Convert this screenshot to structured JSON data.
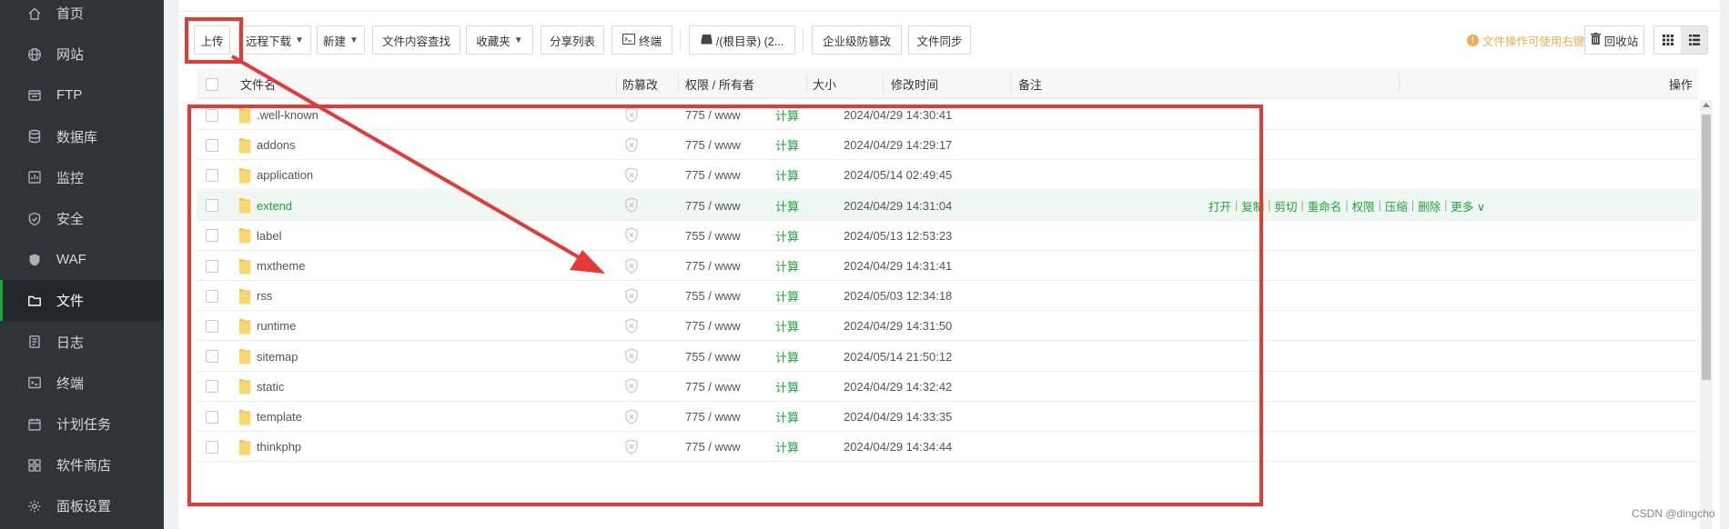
{
  "sidebar": {
    "items": [
      {
        "label": "首页",
        "icon": "home-icon"
      },
      {
        "label": "网站",
        "icon": "globe-icon"
      },
      {
        "label": "FTP",
        "icon": "ftp-icon"
      },
      {
        "label": "数据库",
        "icon": "database-icon"
      },
      {
        "label": "监控",
        "icon": "monitor-icon"
      },
      {
        "label": "安全",
        "icon": "shield-icon"
      },
      {
        "label": "WAF",
        "icon": "waf-shield-icon"
      },
      {
        "label": "文件",
        "icon": "folder-icon",
        "active": true
      },
      {
        "label": "日志",
        "icon": "log-icon"
      },
      {
        "label": "终端",
        "icon": "terminal-icon"
      },
      {
        "label": "计划任务",
        "icon": "calendar-icon"
      },
      {
        "label": "软件商店",
        "icon": "store-icon"
      },
      {
        "label": "面板设置",
        "icon": "gear-icon"
      }
    ]
  },
  "toolbar": {
    "upload": "上传",
    "remote_download": "远程下载",
    "new": "新建",
    "content_search": "文件内容查找",
    "favorites": "收藏夹",
    "share_list": "分享列表",
    "terminal": "终端",
    "path": "/(根目录) (2...",
    "tamper_proof": "企业级防篡改",
    "file_sync": "文件同步",
    "tip": "文件操作可使用右键",
    "recycle_bin": "回收站"
  },
  "table": {
    "headers": {
      "name": "文件名",
      "tamper": "防篡改",
      "perm": "权限 / 所有者",
      "size": "大小",
      "mtime": "修改时间",
      "remark": "备注",
      "ops": "操作"
    },
    "rows": [
      {
        "name": ".well-known",
        "perm": "775 / www",
        "size": "计算",
        "mtime": "2024/04/29 14:30:41"
      },
      {
        "name": "addons",
        "perm": "775 / www",
        "size": "计算",
        "mtime": "2024/04/29 14:29:17"
      },
      {
        "name": "application",
        "perm": "775 / www",
        "size": "计算",
        "mtime": "2024/05/14 02:49:45"
      },
      {
        "name": "extend",
        "perm": "775 / www",
        "size": "计算",
        "mtime": "2024/04/29 14:31:04",
        "hover": true
      },
      {
        "name": "label",
        "perm": "755 / www",
        "size": "计算",
        "mtime": "2024/05/13 12:53:23"
      },
      {
        "name": "mxtheme",
        "perm": "775 / www",
        "size": "计算",
        "mtime": "2024/04/29 14:31:41"
      },
      {
        "name": "rss",
        "perm": "755 / www",
        "size": "计算",
        "mtime": "2024/05/03 12:34:18"
      },
      {
        "name": "runtime",
        "perm": "775 / www",
        "size": "计算",
        "mtime": "2024/04/29 14:31:50"
      },
      {
        "name": "sitemap",
        "perm": "755 / www",
        "size": "计算",
        "mtime": "2024/05/14 21:50:12"
      },
      {
        "name": "static",
        "perm": "775 / www",
        "size": "计算",
        "mtime": "2024/04/29 14:32:42"
      },
      {
        "name": "template",
        "perm": "775 / www",
        "size": "计算",
        "mtime": "2024/04/29 14:33:35"
      },
      {
        "name": "thinkphp",
        "perm": "775 / www",
        "size": "计算",
        "mtime": "2024/04/29 14:34:44"
      }
    ],
    "row_actions": {
      "open": "打开",
      "copy": "复制",
      "cut": "剪切",
      "rename": "重命名",
      "perm": "权限",
      "compress": "压缩",
      "delete": "删除",
      "more": "更多"
    }
  },
  "watermark": "CSDN @dingcho",
  "colors": {
    "accent": "#20a53a",
    "annotation": "#e53935",
    "sidebar": "#2f3438",
    "warn": "#f0ad4e"
  }
}
